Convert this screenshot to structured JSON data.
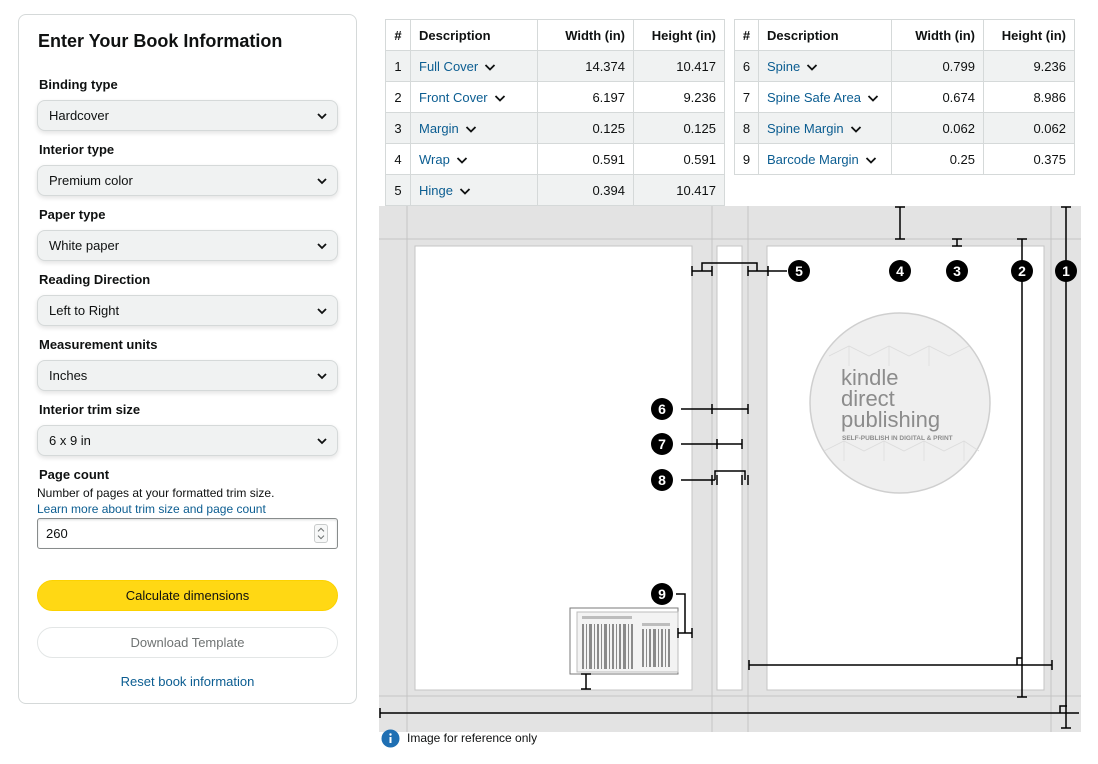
{
  "form": {
    "title": "Enter Your Book Information",
    "fields": [
      {
        "label": "Binding type",
        "value": "Hardcover"
      },
      {
        "label": "Interior type",
        "value": "Premium color"
      },
      {
        "label": "Paper type",
        "value": "White paper"
      },
      {
        "label": "Reading Direction",
        "value": "Left to Right"
      },
      {
        "label": "Measurement units",
        "value": "Inches"
      },
      {
        "label": "Interior trim size",
        "value": "6 x 9 in"
      }
    ],
    "page_count": {
      "label": "Page count",
      "help": "Number of pages at your formatted trim size.",
      "link": "Learn more about trim size and page count",
      "value": "260"
    },
    "calculate_label": "Calculate dimensions",
    "download_label": "Download Template",
    "reset_label": "Reset book information"
  },
  "table_headers": {
    "num": "#",
    "description": "Description",
    "width": "Width (in)",
    "height": "Height (in)"
  },
  "table_left": [
    {
      "num": "1",
      "description": "Full Cover",
      "width": "14.374",
      "height": "10.417"
    },
    {
      "num": "2",
      "description": "Front Cover",
      "width": "6.197",
      "height": "9.236"
    },
    {
      "num": "3",
      "description": "Margin",
      "width": "0.125",
      "height": "0.125"
    },
    {
      "num": "4",
      "description": "Wrap",
      "width": "0.591",
      "height": "0.591"
    },
    {
      "num": "5",
      "description": "Hinge",
      "width": "0.394",
      "height": "10.417"
    }
  ],
  "table_right": [
    {
      "num": "6",
      "description": "Spine",
      "width": "0.799",
      "height": "9.236"
    },
    {
      "num": "7",
      "description": "Spine Safe Area",
      "width": "0.674",
      "height": "8.986"
    },
    {
      "num": "8",
      "description": "Spine Margin",
      "width": "0.062",
      "height": "0.062"
    },
    {
      "num": "9",
      "description": "Barcode Margin",
      "width": "0.25",
      "height": "0.375"
    }
  ],
  "diagram": {
    "logo_line1": "kindle",
    "logo_line2": "direct",
    "logo_line3": "publishing",
    "logo_tagline": "SELF-PUBLISH IN DIGITAL & PRINT",
    "markers": [
      "1",
      "2",
      "3",
      "4",
      "5",
      "6",
      "7",
      "8",
      "9"
    ],
    "note": "Image for reference only"
  },
  "colors": {
    "accent_yellow": "#ffd814",
    "link_blue": "#0b5d91",
    "info_blue": "#1f6fb3",
    "row_gray": "#f0f2f2",
    "diagram_gray": "#e3e3e3"
  }
}
